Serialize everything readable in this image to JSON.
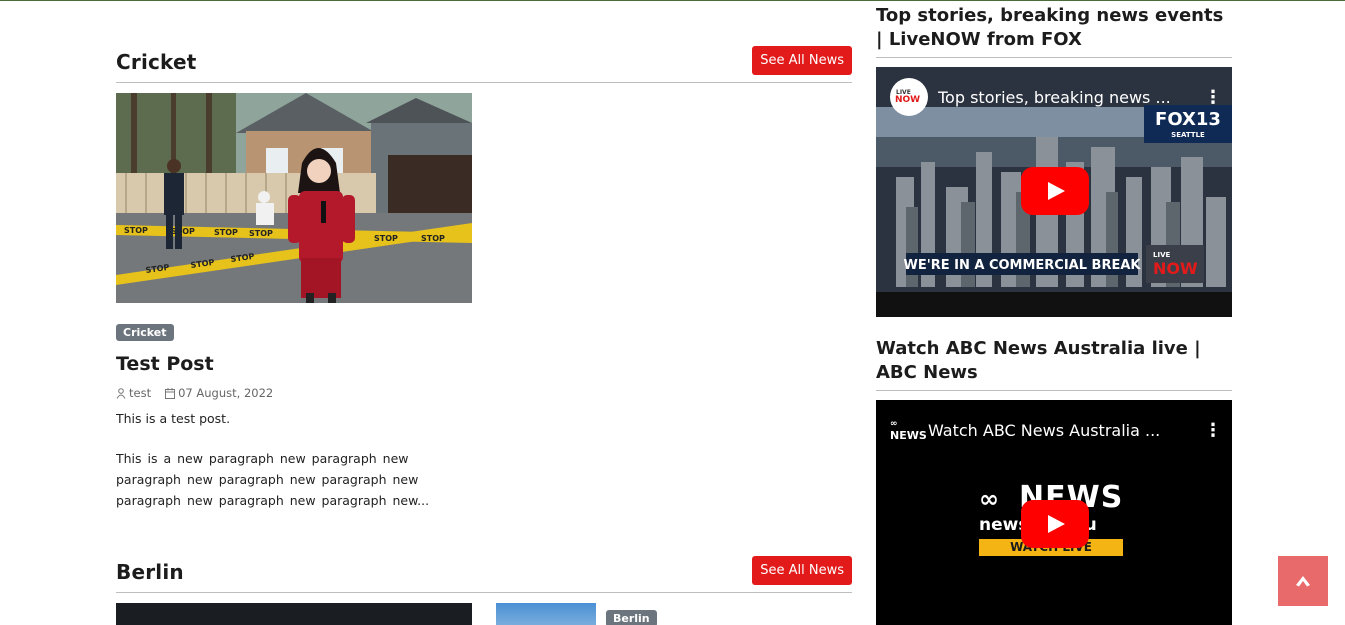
{
  "sections": [
    {
      "title": "Cricket",
      "see_all": "See All News",
      "post": {
        "category": "Cricket",
        "title": "Test Post",
        "author": "test",
        "date": "07 August, 2022",
        "excerpt": "This is a test post.",
        "body": "This is a new paragraph  new paragraph  new paragraph  new paragraph  new paragraph  new paragraph  new paragraph  new paragraph  new..."
      },
      "image_text": {
        "tape_word": "STOP"
      }
    },
    {
      "title": "Berlin",
      "see_all": "See All News",
      "side_badge": "Berlin"
    }
  ],
  "sidebar": {
    "videos": [
      {
        "heading": "Top stories, breaking news events | LiveNOW from FOX",
        "player_title": "Top stories, breaking news ...",
        "channel_logo_top": "LIVE",
        "channel_logo_bottom": "NOW",
        "station": "FOX13",
        "station_city": "SEATTLE",
        "banner": "WE'RE IN A COMMERCIAL BREAK"
      },
      {
        "heading": "Watch ABC News Australia live | ABC News",
        "player_title": "Watch ABC News Australia ...",
        "channel_logo": "NEWS",
        "brand": "NEWS",
        "brand_url": "news.net.au",
        "watch_live": "WATCH LIVE"
      }
    ]
  },
  "colors": {
    "accent_red": "#e31a1a",
    "badge_grey": "#6c757d",
    "back_to_top": "#e86a6a"
  },
  "icons": [
    "user-icon",
    "calendar-icon",
    "youtube-play-icon",
    "kebab-menu-icon",
    "arrow-up-icon"
  ]
}
